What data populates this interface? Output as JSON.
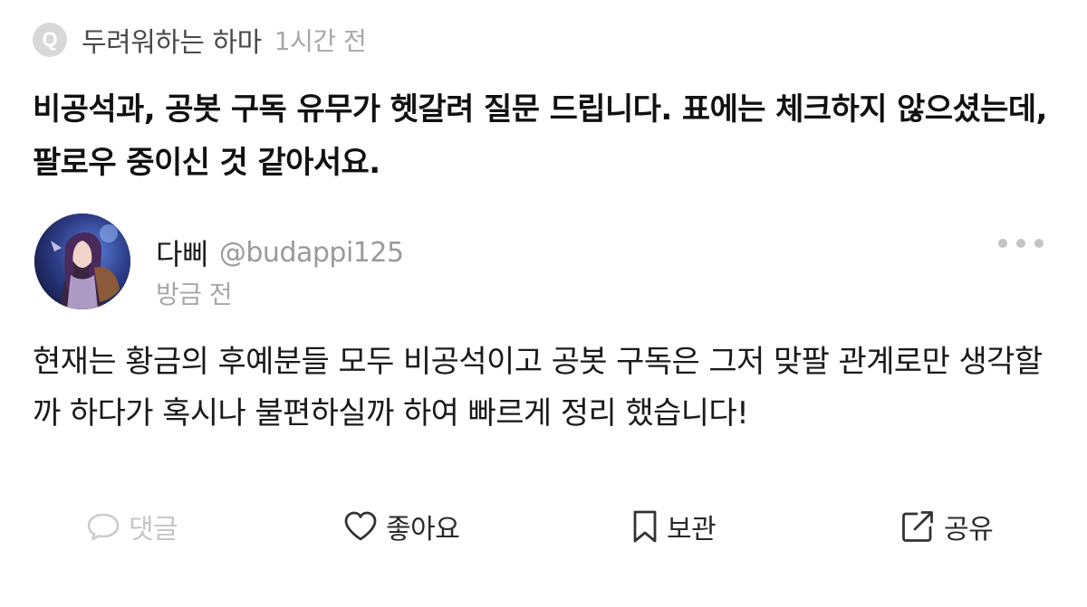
{
  "question": {
    "badge": "Q",
    "author": "두려워하는 하마",
    "time": "1시간 전",
    "body": "비공석과, 공봇 구독 유무가 헷갈려 질문 드립니다. 표에는 체크하지 않으셨는데, 팔로우 중이신 것 같아서요."
  },
  "answer": {
    "avatar_icon": "user-avatar-image",
    "name": "다삐",
    "handle": "@budappi125",
    "time": "방금 전",
    "more_icon": "more-horizontal-icon",
    "body": "현재는 황금의 후예분들 모두 비공석이고 공봇 구독은 그저 맞팔 관계로만 생각할까 하다가 혹시나 불편하실까 하여 빠르게 정리 했습니다!"
  },
  "actions": {
    "comment": {
      "label": "댓글",
      "icon": "speech-bubble-icon",
      "color": "#c6c6c6"
    },
    "like": {
      "label": "좋아요",
      "icon": "heart-icon"
    },
    "save": {
      "label": "보관",
      "icon": "bookmark-icon"
    },
    "share": {
      "label": "공유",
      "icon": "share-icon"
    }
  },
  "colors": {
    "text_primary": "#1a1a1a",
    "text_muted": "#a8a8a8",
    "badge_bg": "#d8d8d8"
  }
}
